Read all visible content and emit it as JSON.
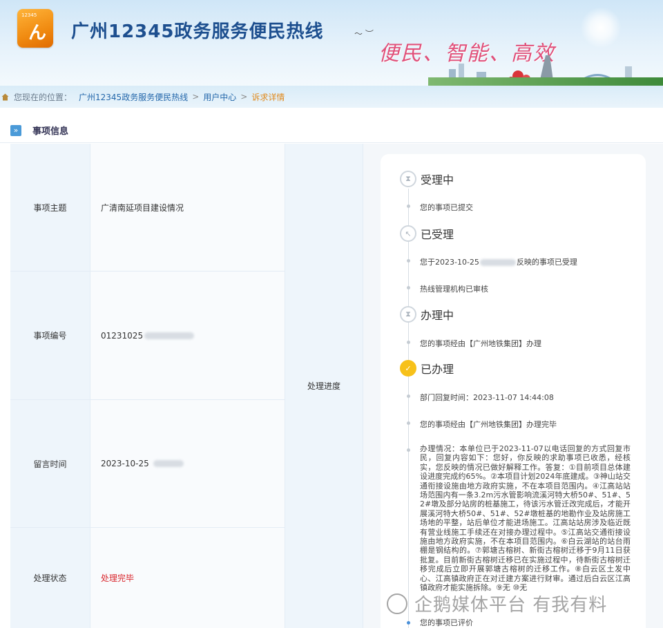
{
  "header": {
    "logo_number": "12345",
    "site_title": "广州12345政务服务便民热线",
    "slogan": "便民、智能、高效"
  },
  "breadcrumb": {
    "prefix": "您现在的位置：",
    "items": [
      "广州12345政务服务便民热线",
      "用户中心"
    ],
    "separator": ">",
    "current": "诉求详情"
  },
  "section": {
    "title": "事项信息"
  },
  "info": {
    "rows": [
      {
        "label": "事项主题",
        "value": "广清南延项目建设情况"
      },
      {
        "label": "事项编号",
        "value": "01231025"
      },
      {
        "label": "留言时间",
        "value": "2023-10-25"
      },
      {
        "label": "处理状态",
        "value": "处理完毕"
      }
    ],
    "progress_label": "处理进度"
  },
  "timeline": {
    "stages": [
      {
        "title": "受理中",
        "steps": [
          "您的事项已提交"
        ]
      },
      {
        "title": "已受理",
        "steps": [
          "您于2023-10-25",
          "反映的事项已受理",
          "热线管理机构已审核"
        ]
      },
      {
        "title": "办理中",
        "steps": [
          "您的事项经由【广州地铁集团】办理"
        ]
      },
      {
        "title": "已办理",
        "steps": [
          "部门回复时间：2023-11-07 14:44:08",
          "您的事项经由【广州地铁集团】办理完毕"
        ]
      }
    ],
    "detail": "办理情况：本单位已于2023-11-07以电话回复的方式回复市民，回复内容如下：您好，你反映的求助事项已收悉，经核实，您反映的情况已做好解释工作。答复：①目前项目总体建设进度完成约65%。②本项目计划2024年底建成。③神山站交通衔接设施由地方政府实施，不在本项目范围内。④江高站站场范围内有一条3.2m污水管影响流溪河特大桥50#、51#、52#墩及部分站房的桩基施工，待该污水管迁改完成后，才能开展溪河特大桥50#、51#、52#墩桩基的地勘作业及站房施工场地的平整，站后单位才能进场施工。江高站站房涉及临近既有营业线施工手续还在对接办理过程中。⑤江高站交通衔接设施由地方政府实施，不在本项目范围内。⑥白云湖站的站台雨棚是钢结构的。⑦郭塘古榕树、新街古榕树迁移于9月11日获批复。目前新街古榕树迁移已在实施过程中，待新街古榕树迁移完成后立即开展郭塘古榕树的迁移工作。⑧白云区土发中心、江高镇政府正在对迁建方案进行财审。通过后白云区江高镇政府才能实施拆除。⑨无 ⑩无",
    "last_step": "您的事项已评价"
  },
  "watermark": "企鹅媒体平台 有我有料"
}
